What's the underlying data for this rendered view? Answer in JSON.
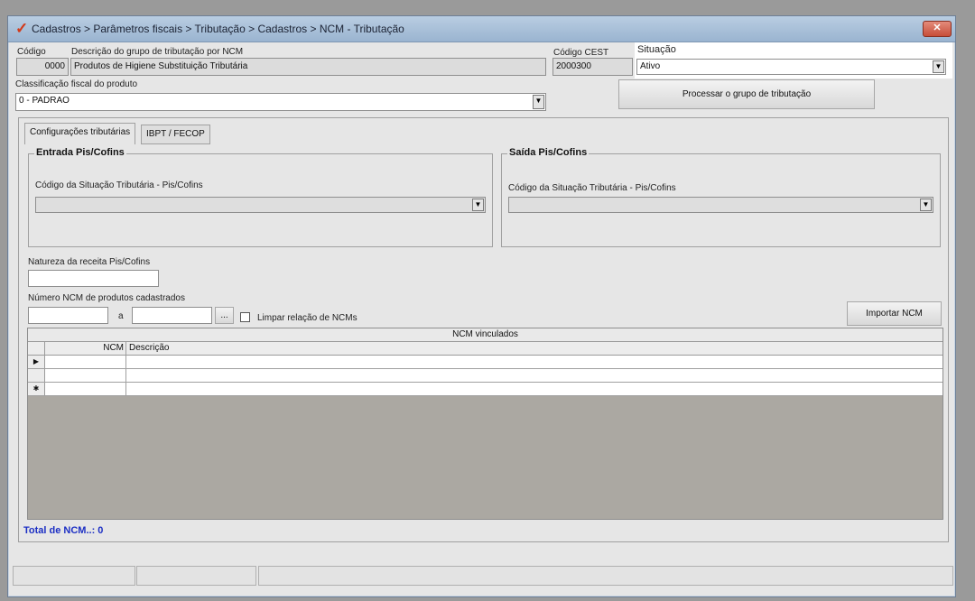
{
  "window": {
    "title": "Cadastros > Parâmetros fiscais > Tributação > Cadastros > NCM - Tributação",
    "close_symbol": "✕",
    "app_icon_glyph": "✓",
    "app_icon_name": "app-logo-icon"
  },
  "header": {
    "codigo_label": "Código",
    "codigo_value": "0000",
    "descricao_label": "Descrição do grupo de tributação por NCM",
    "descricao_value": "Produtos de Higiene Substituição Tributária",
    "cest_label": "Código CEST",
    "cest_value": "2000300",
    "situacao_label": "Situação",
    "situacao_value": "Ativo",
    "classificacao_label": "Classificação fiscal do produto",
    "classificacao_value": "0 - PADRAO",
    "processar_button": "Processar o grupo de tributação"
  },
  "tabs": [
    {
      "label": "Configurações tributárias",
      "active": true
    },
    {
      "label": "IBPT / FECOP",
      "active": false
    }
  ],
  "entrada": {
    "title": "Entrada Pis/Cofins",
    "cst_label": "Código da Situação Tributária - Pis/Cofins",
    "cst_value": ""
  },
  "saida": {
    "title": "Saída Pis/Cofins",
    "cst_label": "Código da Situação Tributária - Pis/Cofins",
    "cst_value": ""
  },
  "natureza": {
    "label": "Natureza da receita Pis/Cofins",
    "value": ""
  },
  "ncm_range": {
    "label": "Número  NCM de produtos cadastrados",
    "from_value": "",
    "separator": "a",
    "to_value": "",
    "ellipsis_button": "...",
    "clear_checkbox_label": "Limpar relação de NCMs",
    "clear_checked": false,
    "import_button": "Importar NCM"
  },
  "grid": {
    "caption": "NCM vinculados",
    "columns": [
      "NCM",
      "Descrição"
    ],
    "rows": [
      {
        "indicator": "▶",
        "ncm": "",
        "descricao": ""
      },
      {
        "indicator": "",
        "ncm": "",
        "descricao": ""
      },
      {
        "indicator": "✱",
        "ncm": "",
        "descricao": ""
      }
    ]
  },
  "footer": {
    "total_label": "Total de NCM..: 0"
  },
  "colors": {
    "total_text": "#1c2fc4",
    "title_bar": "#9ab4d0",
    "grid_background": "#aba8a2"
  }
}
